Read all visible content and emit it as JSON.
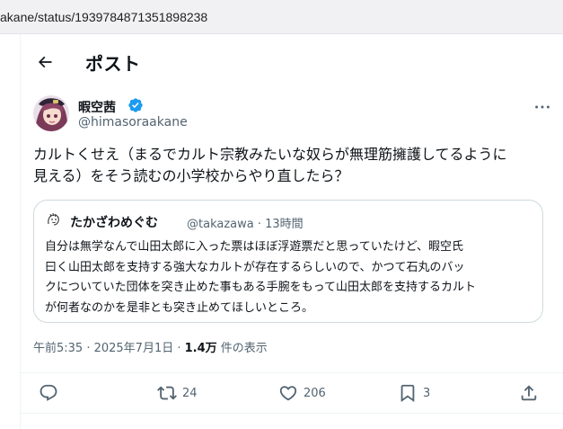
{
  "browser": {
    "url": "akane/status/1939784871351898238"
  },
  "header": {
    "back_icon": "arrow-left-icon",
    "title": "ポスト"
  },
  "post": {
    "author": {
      "display_name": "暇空茜",
      "handle": "@himasoraakane",
      "verified": true,
      "verified_color": "#1d9bf0"
    },
    "text_lines": [
      "カルトくせえ（まるでカルト宗教みたいな奴らが無理筋擁護してるように",
      "見える）をそう読むの小学校からやり直したら？"
    ],
    "quote": {
      "display_name": "たかざわめぐむ",
      "handle": "@takazawa · 13時間",
      "text_lines": [
        "自分は無学なんで山田太郎に入った票はほぼ浮遊票だと思っていたけど、暇空氏",
        "曰く山田太郎を支持する強大なカルトが存在するらしいので、かつて石丸のバッ",
        "クについていた団体を突き止めた事もある手腕をもって山田太郎を支持するカルト",
        "が何者なのかを是非とも突き止めてほしいところ。"
      ]
    },
    "meta": {
      "timestamp": "午前5:35 · 2025年7月1日 · ",
      "views_count": "1.4万",
      "views_label": " 件の表示"
    },
    "actions": {
      "reply_icon": "reply-icon",
      "retweet_icon": "retweet-icon",
      "retweet_count": "24",
      "like_icon": "heart-icon",
      "like_count": "206",
      "bookmark_icon": "bookmark-icon",
      "bookmark_count": "3",
      "share_icon": "share-icon"
    }
  },
  "colors": {
    "text_primary": "#0f1419",
    "text_secondary": "#536471",
    "border": "#cfd9de",
    "accent": "#1d9bf0"
  }
}
